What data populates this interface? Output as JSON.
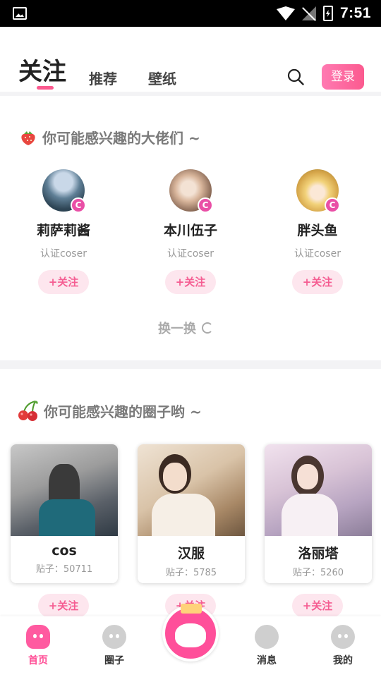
{
  "status_bar": {
    "time": "7:51"
  },
  "header": {
    "tabs": [
      {
        "label": "关注"
      },
      {
        "label": "推荐"
      },
      {
        "label": "壁纸"
      }
    ],
    "login_label": "登录"
  },
  "users_section": {
    "title": "你可能感兴趣的大佬们 ~",
    "badge": "C",
    "follow_label": "+关注",
    "users": [
      {
        "name": "莉萨莉酱",
        "role": "认证coser"
      },
      {
        "name": "本川伍子",
        "role": "认证coser"
      },
      {
        "name": "胖头鱼",
        "role": "认证coser"
      }
    ],
    "refresh_label": "换一换"
  },
  "circles_section": {
    "title": "你可能感兴趣的圈子哟 ~",
    "follow_label": "+关注",
    "circles": [
      {
        "name": "cos",
        "posts": "贴子：50711"
      },
      {
        "name": "汉服",
        "posts": "贴子：5785"
      },
      {
        "name": "洛丽塔",
        "posts": "贴子：5260"
      }
    ]
  },
  "bottom_nav": {
    "items": [
      {
        "label": "首页"
      },
      {
        "label": "圈子"
      },
      {
        "label": "消息"
      },
      {
        "label": "我的"
      }
    ]
  },
  "colors": {
    "accent": "#fb5a8f",
    "follow_bg": "#fde6ee",
    "status_bar": "#000000"
  }
}
